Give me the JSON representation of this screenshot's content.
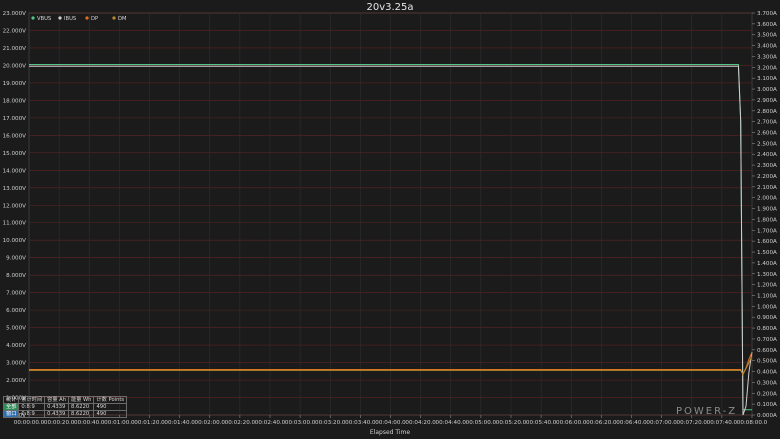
{
  "chart_data": {
    "type": "line",
    "title": "20v3.25a",
    "xlabel": "Elapsed Time",
    "x_ticks": [
      "00:00:00.0",
      "00:00:20.0",
      "00:00:40.0",
      "00:01:00.0",
      "00:01:20.0",
      "00:01:40.0",
      "00:02:00.0",
      "00:02:20.0",
      "00:02:40.0",
      "00:03:00.0",
      "00:03:20.0",
      "00:03:40.0",
      "00:04:00.0",
      "00:04:20.0",
      "00:04:40.0",
      "00:05:00.0",
      "00:05:20.0",
      "00:05:40.0",
      "00:06:00.0",
      "00:06:20.0",
      "00:06:40.0",
      "00:07:00.0",
      "00:07:20.0",
      "00:07:40.0",
      "00:08:00.0"
    ],
    "xlim": [
      0,
      480
    ],
    "y_left": {
      "ticks": [
        "0.000V",
        "1.000V",
        "2.000V",
        "3.000V",
        "4.000V",
        "5.000V",
        "6.000V",
        "7.000V",
        "8.000V",
        "9.000V",
        "10.000V",
        "11.000V",
        "12.000V",
        "13.000V",
        "14.000V",
        "15.000V",
        "16.000V",
        "17.000V",
        "18.000V",
        "19.000V",
        "20.000V",
        "21.000V",
        "22.000V",
        "23.000V"
      ],
      "lim": [
        0,
        23
      ]
    },
    "y_right": {
      "ticks": [
        "0.000A",
        "0.100A",
        "0.200A",
        "0.300A",
        "0.400A",
        "0.500A",
        "0.600A",
        "0.700A",
        "0.800A",
        "0.900A",
        "1.000A",
        "1.100A",
        "1.200A",
        "1.300A",
        "1.400A",
        "1.500A",
        "1.600A",
        "1.700A",
        "1.800A",
        "1.900A",
        "2.000A",
        "2.100A",
        "2.200A",
        "2.300A",
        "2.400A",
        "2.500A",
        "2.600A",
        "2.700A",
        "2.800A",
        "2.900A",
        "3.000A",
        "3.100A",
        "3.200A",
        "3.300A",
        "3.400A",
        "3.500A",
        "3.600A",
        "3.700A"
      ],
      "lim": [
        0,
        3.7
      ]
    },
    "legend_placement": "top-left",
    "grid": true,
    "series": [
      {
        "name": "VBUS",
        "axis": "left",
        "color": "#4ec68a",
        "x": [
          0,
          471,
          472.5,
          474,
          480
        ],
        "y": [
          20.05,
          20.05,
          16.8,
          0.3,
          0.3
        ]
      },
      {
        "name": "IBUS",
        "axis": "right",
        "color": "#cfcfcf",
        "x": [
          0,
          471,
          472.5,
          474,
          476,
          478,
          480
        ],
        "y": [
          3.21,
          3.21,
          2.7,
          0.0,
          0.08,
          0.4,
          0.58
        ]
      },
      {
        "name": "DP",
        "axis": "left",
        "color": "#e07020",
        "x": [
          0,
          471,
          472.5,
          474,
          476,
          478,
          480
        ],
        "y": [
          2.6,
          2.6,
          2.6,
          2.3,
          2.7,
          3.2,
          3.6
        ]
      },
      {
        "name": "DM",
        "axis": "left",
        "color": "#b8892e",
        "x": [
          0,
          471,
          472.5,
          474,
          476,
          478,
          480
        ],
        "y": [
          2.55,
          2.55,
          2.55,
          2.35,
          2.65,
          3.0,
          3.4
        ]
      }
    ]
  },
  "stats_table": {
    "header": [
      "统计",
      "累计时间",
      "容量 Ah",
      "能量 Wh",
      "计数 Points"
    ],
    "rows": [
      {
        "badge": "全部",
        "badge_color": "#2e8b57",
        "cells": [
          "0:8:9",
          "0.4339",
          "8.6220",
          "490"
        ]
      },
      {
        "badge": "窗口",
        "badge_color": "#2f6fb0",
        "cells": [
          "0:8:9",
          "0.4339",
          "8.6220",
          "490"
        ]
      }
    ]
  },
  "watermark": "POWER-Z"
}
